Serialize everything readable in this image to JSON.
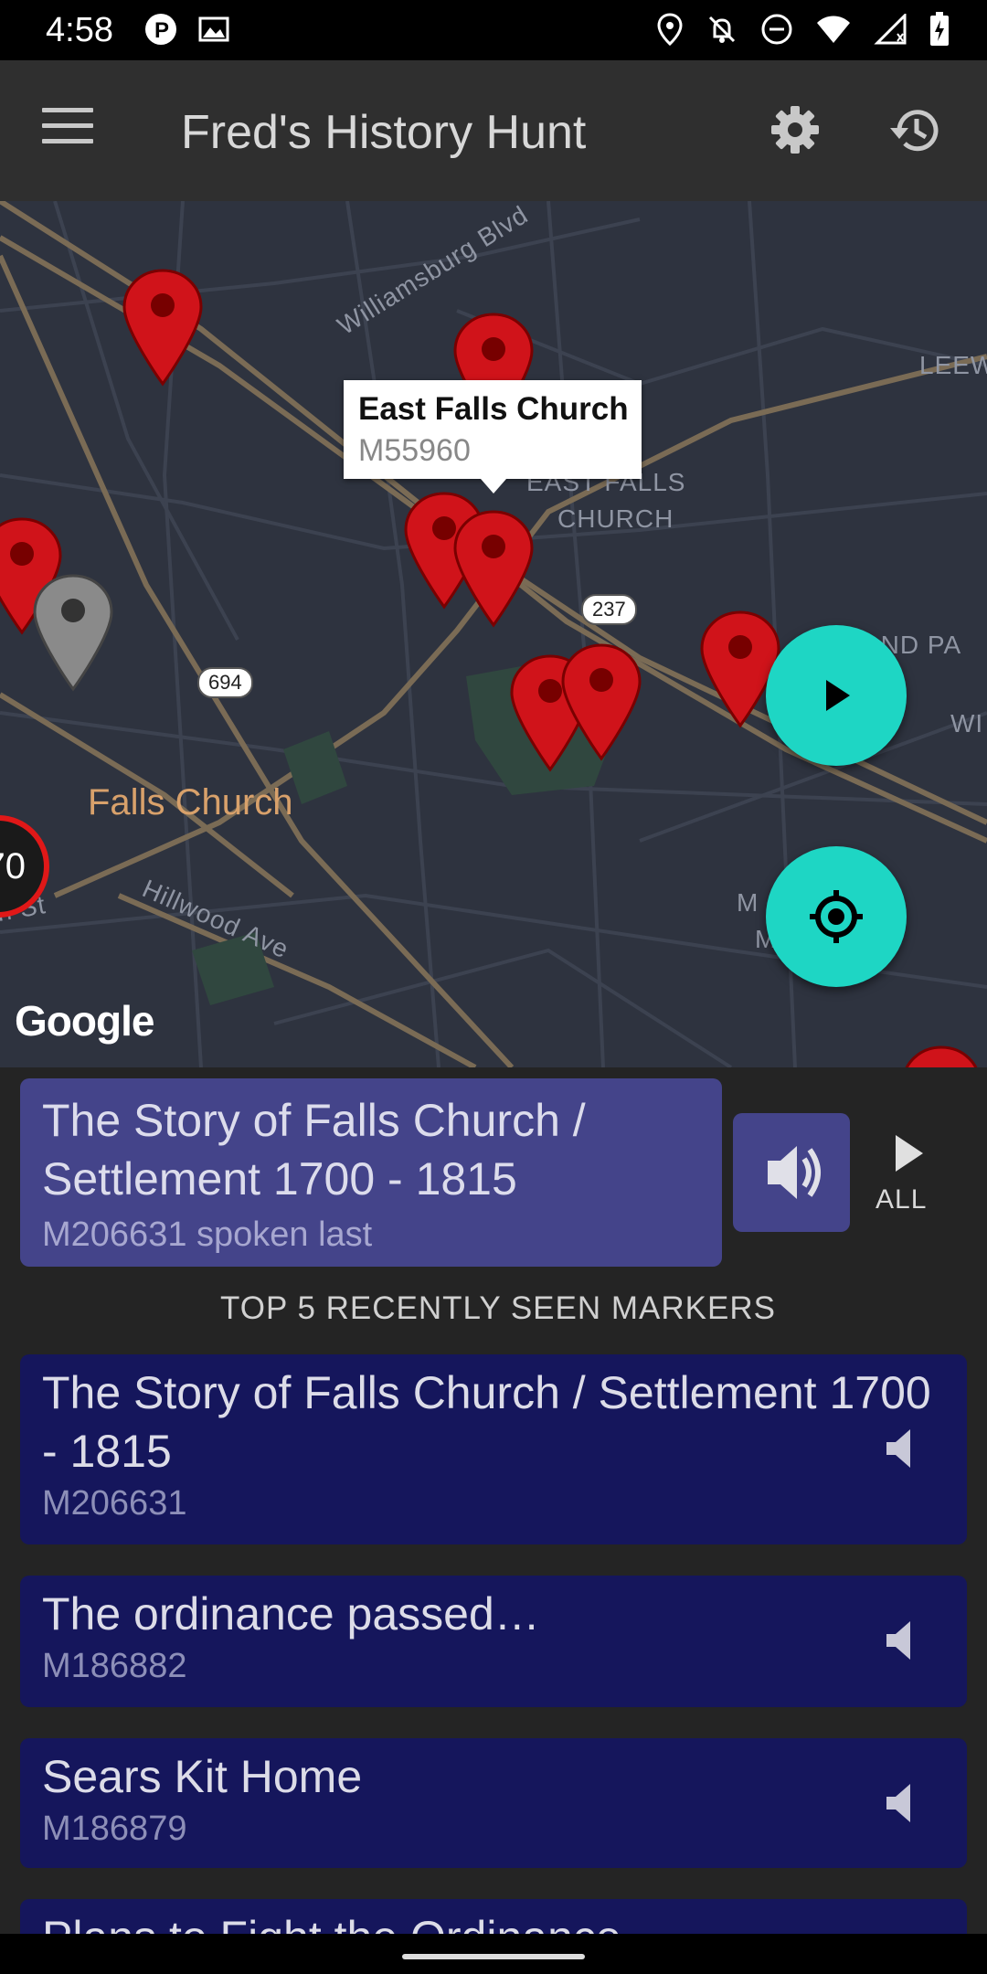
{
  "status_bar": {
    "time": "4:58",
    "icons": [
      "circle-p-icon",
      "photo-icon",
      "location-icon",
      "notifications-off-icon",
      "do-not-disturb-icon",
      "wifi-icon",
      "signal-icon",
      "battery-charging-icon"
    ]
  },
  "app_bar": {
    "title": "Fred's History Hunt",
    "menu_icon": "menu-icon",
    "settings_icon": "gear-icon",
    "history_icon": "history-icon"
  },
  "map": {
    "info_window": {
      "title": "East Falls Church",
      "subtitle": "M55960"
    },
    "labels": {
      "williamsburg": "Williamsburg Blvd",
      "east_falls_church_1": "EAST FALLS",
      "east_falls_church_2": "CHURCH",
      "town": "Falls Church",
      "hillwood": "Hillwood Ave",
      "leew": "LEEW",
      "and_pa": "AND PA",
      "wi": "WI",
      "st": "on St",
      "m1": "M",
      "m2": "M"
    },
    "shields": {
      "r237": "237",
      "r694": "694"
    },
    "cluster_count": "70",
    "google_logo": "Google",
    "colors": {
      "pin": "#d0131a",
      "pin_gray": "#8a8a8a",
      "fab": "#1ed6c4"
    }
  },
  "now_playing": {
    "title": "The Story of Falls Church / Settlement 1700 - 1815",
    "subtitle": "M206631 spoken last",
    "speak_icon": "volume-icon",
    "play_all_label": "ALL"
  },
  "recent": {
    "heading": "TOP 5 RECENTLY SEEN MARKERS",
    "items": [
      {
        "title": "The Story of Falls Church / Settlement 1700 - 1815",
        "id": "M206631"
      },
      {
        "title": "The ordinance passed…",
        "id": "M186882"
      },
      {
        "title": "Sears Kit Home",
        "id": "M186879"
      },
      {
        "title": "Plans to Fight the Ordinance",
        "id": ""
      }
    ]
  }
}
